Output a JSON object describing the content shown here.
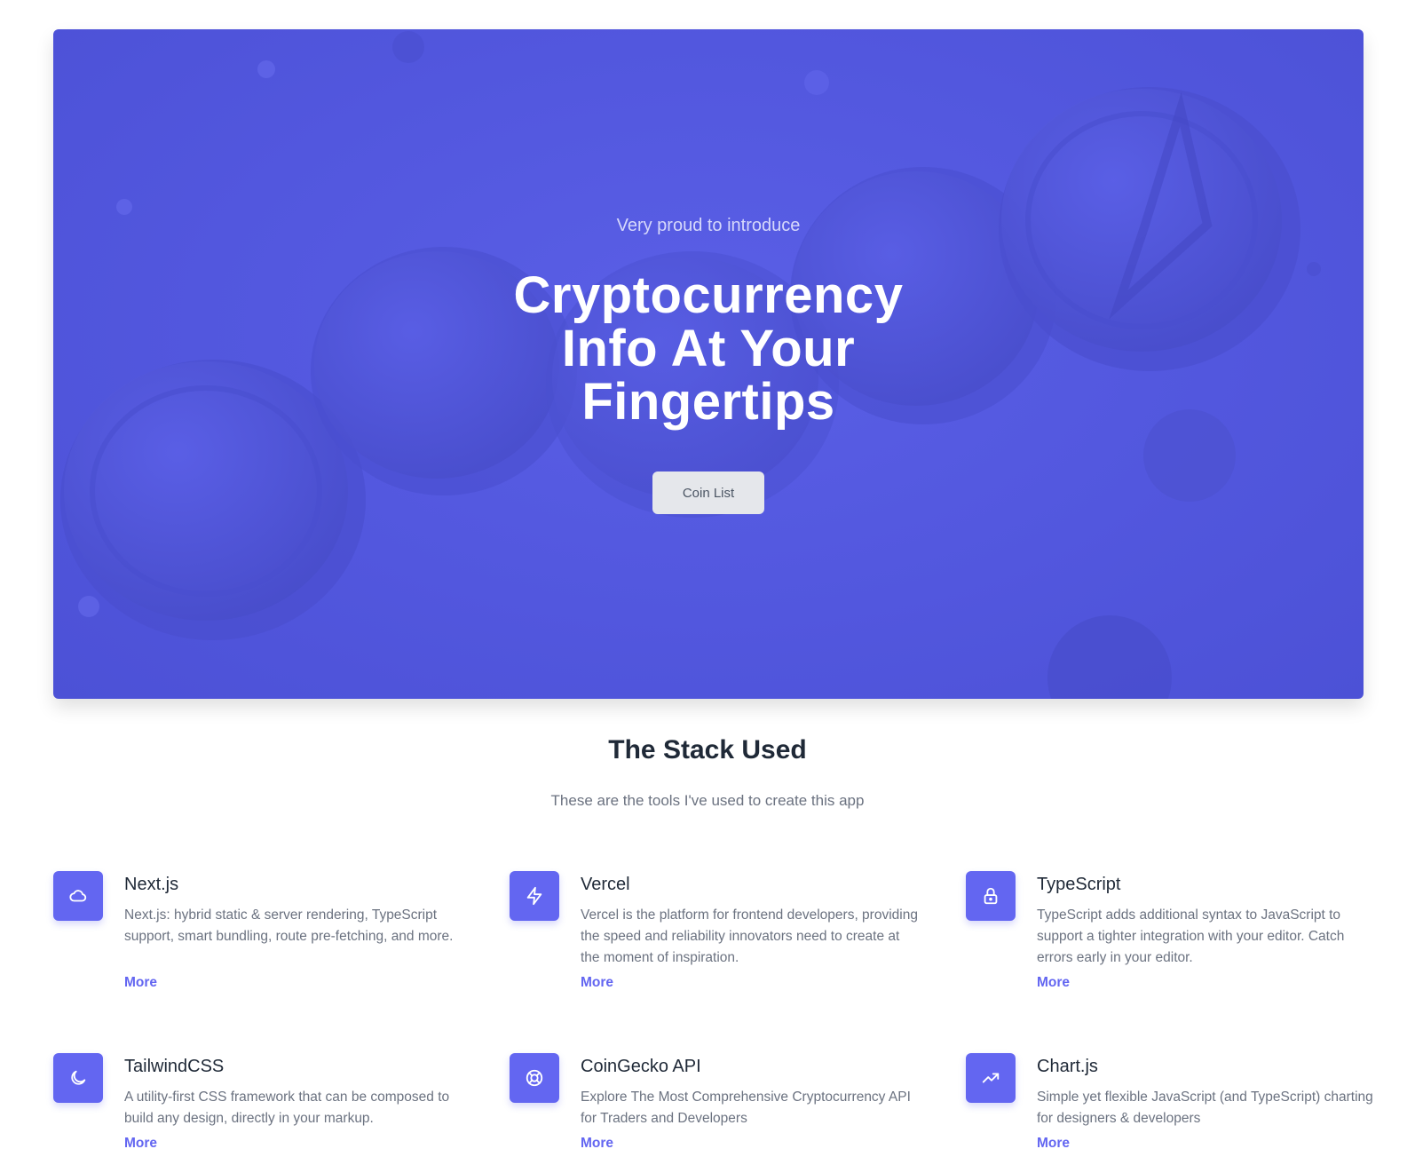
{
  "hero": {
    "kicker": "Very proud to introduce",
    "title_lines": [
      "Cryptocurrency",
      "Info At Your",
      "Fingertips"
    ],
    "button_label": "Coin List",
    "background_color": "#5257de"
  },
  "stack": {
    "title": "The Stack Used",
    "subtitle": "These are the tools I've used to create this app",
    "accent_color": "#6366f1",
    "items": [
      {
        "icon": "cloud-icon",
        "title": "Next.js",
        "description": "Next.js: hybrid static & server rendering, TypeScript support, smart bundling, route pre-fetching, and more.",
        "link": "More"
      },
      {
        "icon": "lightning-icon",
        "title": "Vercel",
        "description": "Vercel is the platform for frontend developers, providing the speed and reliability innovators need to create at the moment of inspiration.",
        "link": "More"
      },
      {
        "icon": "lock-icon",
        "title": "TypeScript",
        "description": "TypeScript adds additional syntax to JavaScript to support a tighter integration with your editor. Catch errors early in your editor.",
        "link": "More"
      },
      {
        "icon": "moon-icon",
        "title": "TailwindCSS",
        "description": "A utility-first CSS framework that can be composed to build any design, directly in your markup.",
        "link": "More"
      },
      {
        "icon": "lifebuoy-icon",
        "title": "CoinGecko API",
        "description": "Explore The Most Comprehensive Cryptocurrency API for Traders and Developers",
        "link": "More"
      },
      {
        "icon": "trending-up-icon",
        "title": "Chart.js",
        "description": "Simple yet flexible JavaScript (and TypeScript) charting for designers & developers",
        "link": "More"
      }
    ]
  }
}
